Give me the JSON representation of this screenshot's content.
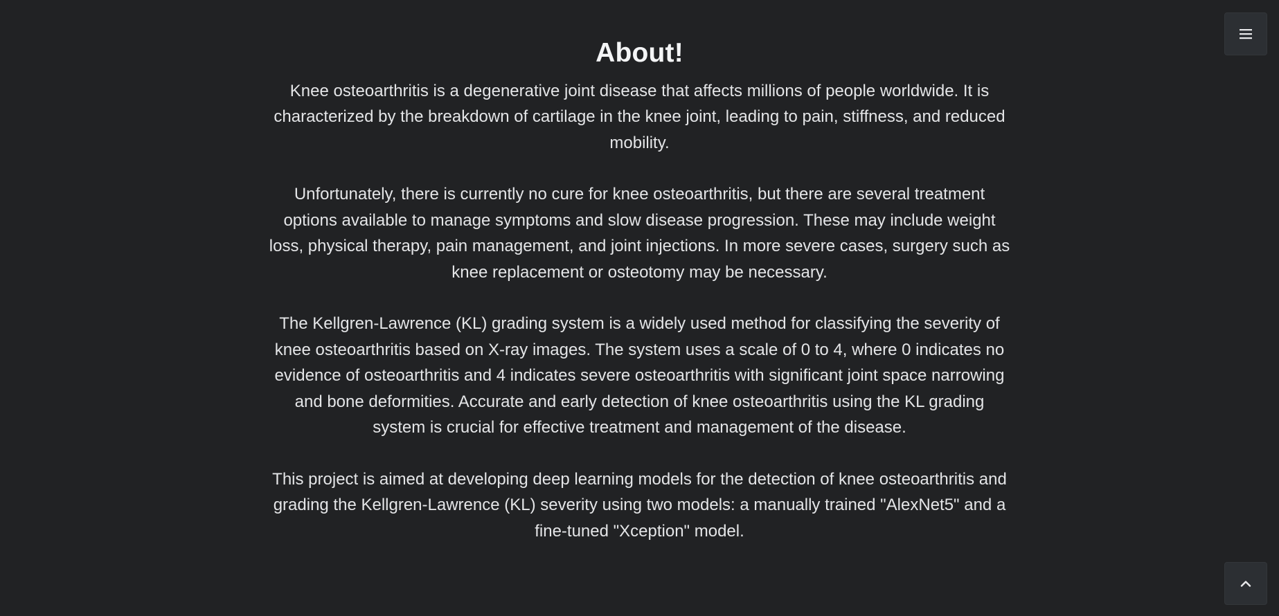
{
  "header": {
    "menu_icon": "hamburger-menu-icon"
  },
  "about": {
    "title": "About!",
    "paragraphs": [
      "Knee osteoarthritis is a degenerative joint disease that affects millions of people worldwide. It is characterized by the breakdown of cartilage in the knee joint, leading to pain, stiffness, and reduced mobility.",
      "Unfortunately, there is currently no cure for knee osteoarthritis, but there are several treatment options available to manage symptoms and slow disease progression. These may include weight loss, physical therapy, pain management, and joint injections. In more severe cases, surgery such as knee replacement or osteotomy may be necessary.",
      "The Kellgren-Lawrence (KL) grading system is a widely used method for classifying the severity of knee osteoarthritis based on X-ray images. The system uses a scale of 0 to 4, where 0 indicates no evidence of osteoarthritis and 4 indicates severe osteoarthritis with significant joint space narrowing and bone deformities. Accurate and early detection of knee osteoarthritis using the KL grading system is crucial for effective treatment and management of the disease.",
      "This project is aimed at developing deep learning models for the detection of knee osteoarthritis and grading the Kellgren-Lawrence (KL) severity using two models: a manually trained \"AlexNet5\" and a fine-tuned \"Xception\" model."
    ]
  },
  "footer": {
    "scroll_top_icon": "chevron-up-icon"
  },
  "colors": {
    "background": "#212224",
    "button_background": "#2c2f33",
    "text": "#e9eaec"
  }
}
